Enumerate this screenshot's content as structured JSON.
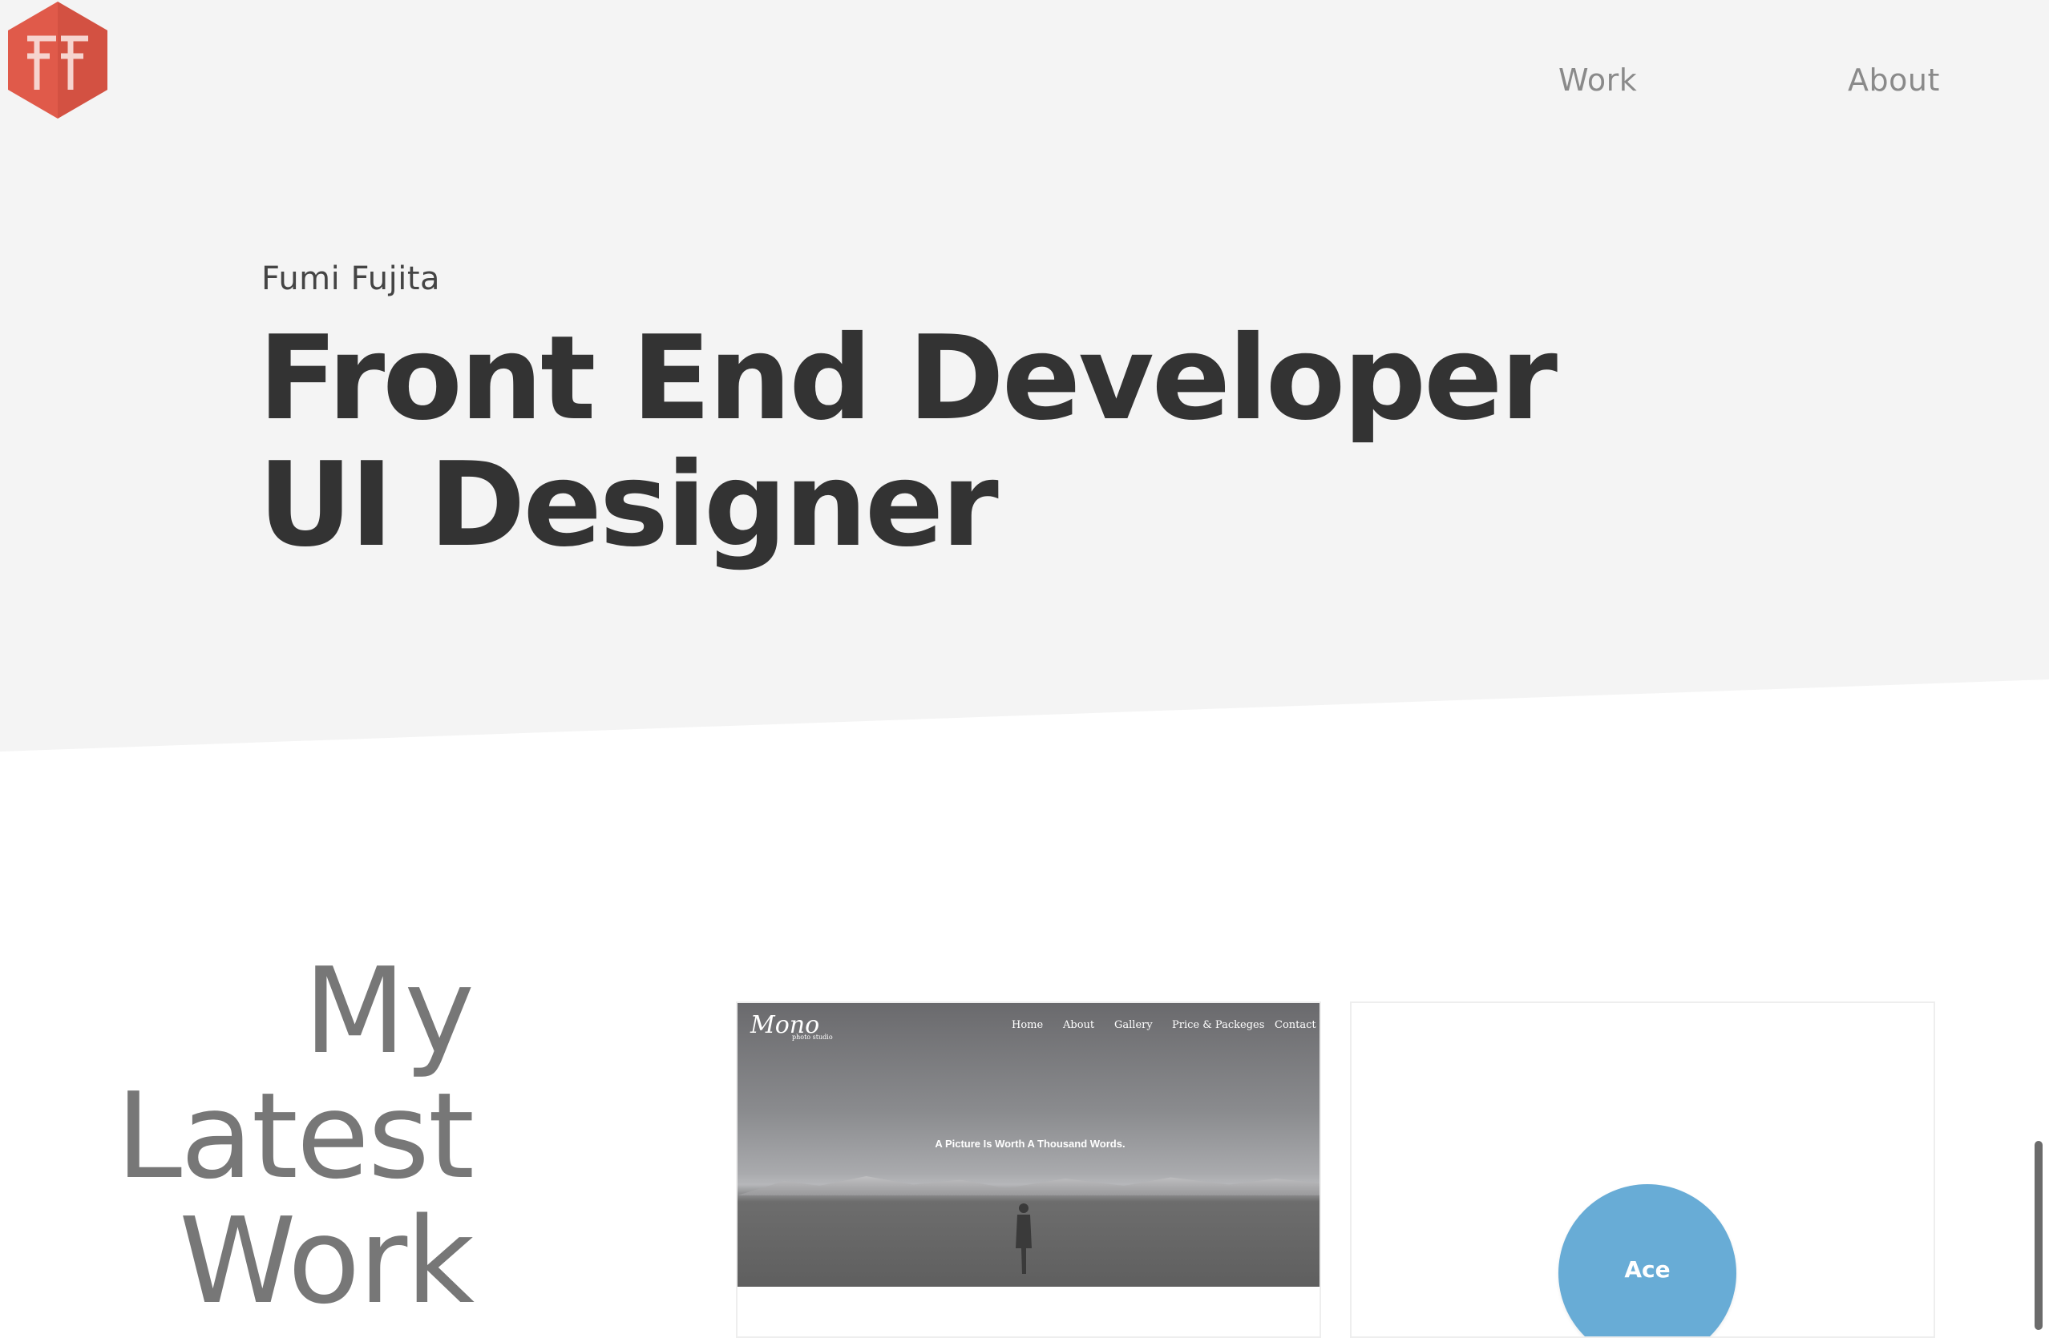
{
  "header": {
    "logo_icon": "ff-hexagon-logo-icon",
    "brand_color": "#e05a4a",
    "nav": [
      {
        "label": "Work"
      },
      {
        "label": "About"
      }
    ]
  },
  "hero": {
    "name": "Fumi Fujita",
    "title": "Front End Developer UI Designer"
  },
  "work": {
    "heading_lines": [
      "My",
      "Latest",
      "Work"
    ],
    "projects": [
      {
        "logo": "Mono",
        "logo_sub": "photo studio",
        "nav": [
          "Home",
          "About",
          "Gallery",
          "Price & Packeges",
          "Contact"
        ],
        "tagline": "A Picture Is Worth A Thousand Words."
      },
      {
        "badge": "Ace",
        "badge_color": "#68acd6"
      }
    ]
  }
}
